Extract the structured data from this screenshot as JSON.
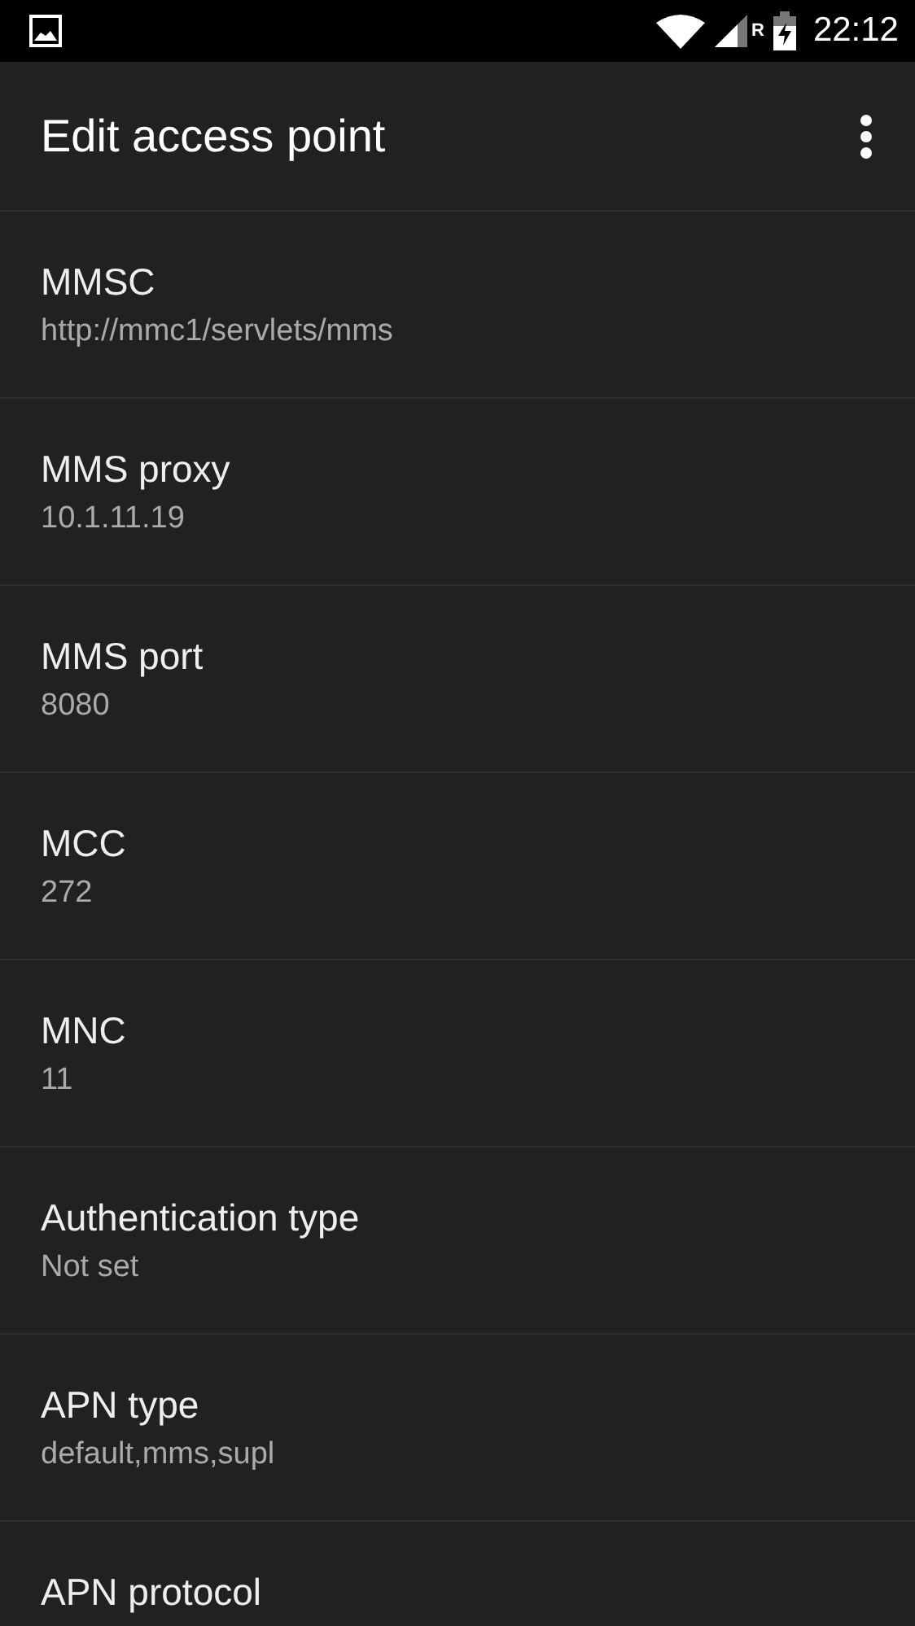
{
  "status_bar": {
    "time": "22:12",
    "roaming": "R"
  },
  "app_bar": {
    "title": "Edit access point"
  },
  "settings": [
    {
      "title": "MMSC",
      "value": "http://mmc1/servlets/mms"
    },
    {
      "title": "MMS proxy",
      "value": "10.1.11.19"
    },
    {
      "title": "MMS port",
      "value": "8080"
    },
    {
      "title": "MCC",
      "value": "272"
    },
    {
      "title": "MNC",
      "value": "11"
    },
    {
      "title": "Authentication type",
      "value": "Not set"
    },
    {
      "title": "APN type",
      "value": "default,mms,supl"
    },
    {
      "title": "APN protocol"
    }
  ]
}
